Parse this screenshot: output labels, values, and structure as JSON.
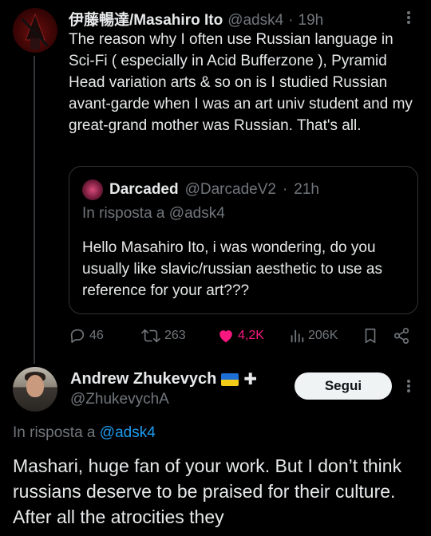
{
  "tweet": {
    "author_name": "伊藤暢達/Masahiro Ito",
    "handle": "@adsk4",
    "separator": "·",
    "time": "19h",
    "text": "The reason why I often use Russian language in Sci-Fi ( especially in Acid Bufferzone ), Pyramid Head variation arts & so on is I studied Russian avant-garde when I was an art univ student and my great-grand mother was Russian. That's all."
  },
  "quoted": {
    "author_name": "Darcaded",
    "handle": "@DarcadeV2",
    "separator": "·",
    "time": "21h",
    "reply_to": "In risposta a @adsk4",
    "text": "Hello Masahiro Ito, i was wondering, do you usually like slavic/russian aesthetic to use as reference for your art???"
  },
  "actions": {
    "replies": "46",
    "reposts": "263",
    "likes": "4,2K",
    "views": "206K"
  },
  "reply": {
    "author_name": "Andrew Zhukevych",
    "handle": "@ZhukevychA",
    "follow_label": "Segui",
    "reply_prefix": "In risposta a",
    "reply_to_handle": "@adsk4",
    "text": "Mashari, huge fan of your work. But I don’t think russians deserve to be praised for their culture. After all the atrocities they"
  },
  "colors": {
    "like": "#f91880",
    "link": "#1d9bf0",
    "muted": "#71767b"
  },
  "icons": [
    "more-icon",
    "reply-icon",
    "repost-icon",
    "like-icon",
    "views-icon",
    "bookmark-icon",
    "share-icon",
    "ukraine-flag-icon",
    "plus-icon"
  ]
}
